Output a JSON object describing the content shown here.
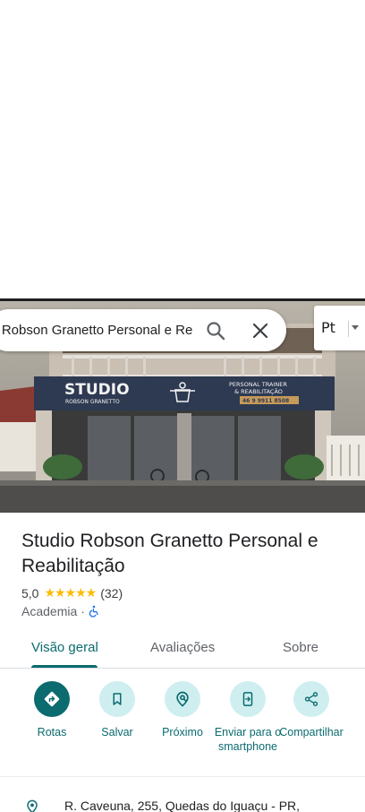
{
  "search": {
    "query": "io Robson Granetto Personal e Rea"
  },
  "layer_button": {
    "label": "Pt"
  },
  "hero": {
    "sign_main": "STUDIO",
    "sign_sub": "ROBSON GRANETTO",
    "sign_right_1": "PERSONAL TRAINER",
    "sign_right_2": "& REABILITAÇÃO",
    "sign_phone": "46 9 9911 8508"
  },
  "place": {
    "name": "Studio Robson Granetto Personal e Reabilitação",
    "rating": "5,0",
    "stars": "★★★★★",
    "review_count": "(32)",
    "category": "Academia",
    "separator": "·"
  },
  "tabs": [
    {
      "label": "Visão geral"
    },
    {
      "label": "Avaliações"
    },
    {
      "label": "Sobre"
    }
  ],
  "actions": [
    {
      "label": "Rotas"
    },
    {
      "label": "Salvar"
    },
    {
      "label": "Próximo"
    },
    {
      "label": "Enviar para o smartphone"
    },
    {
      "label": "Compartilhar"
    }
  ],
  "address": {
    "text": "R. Caveuna, 255, Quedas do Iguaçu - PR,"
  },
  "colors": {
    "accent": "#0b6b6f",
    "accent_light": "#cfeef0",
    "star": "#fbbc04"
  }
}
